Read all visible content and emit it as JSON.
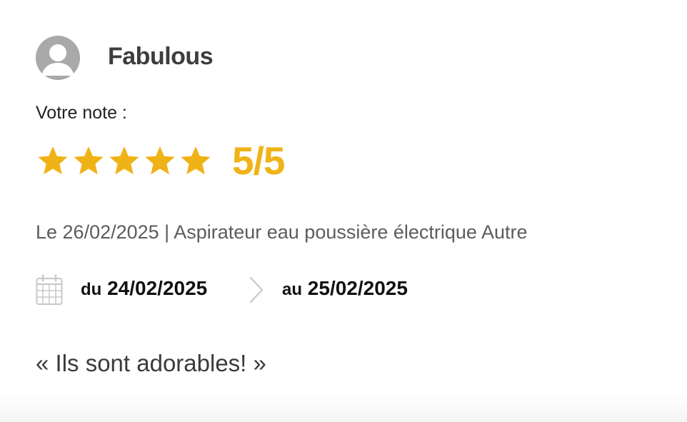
{
  "review": {
    "author": "Fabulous",
    "rating_label": "Votre note :",
    "rating_value": 5,
    "rating_max": 5,
    "score_text": "5/5",
    "star_color": "#f0b317",
    "meta": "Le 26/02/2025 | Aspirateur eau poussière électrique Autre",
    "stay": {
      "from_prefix": "du",
      "from_date": "24/02/2025",
      "to_prefix": "au",
      "to_date": "25/02/2025"
    },
    "comment": "« Ils sont adorables! »"
  },
  "icons": {
    "avatar": "user-avatar-icon",
    "star": "star-icon",
    "calendar": "calendar-icon",
    "separator": "chevron-right-icon"
  }
}
